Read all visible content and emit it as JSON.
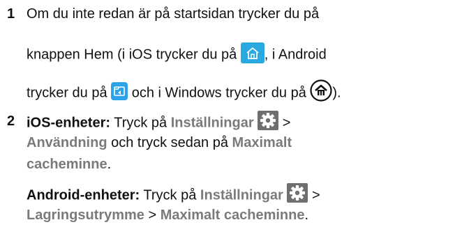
{
  "step1": {
    "number": "1",
    "line1": "Om du inte redan är på startsidan trycker du på",
    "line2_pre": "knappen Hem (i iOS trycker du på ",
    "line2_post": ", i Android",
    "line3_pre": "trycker du på ",
    "line3_mid": " och i Windows trycker du på ",
    "line3_post": ")."
  },
  "step2": {
    "number": "2",
    "ios_label": "iOS-enheter:",
    "ios_text1": " Tryck på ",
    "ios_settings": "Inställningar",
    "ios_gt1": " >",
    "ios_usage": "Användning",
    "ios_text2": " och tryck sedan på ",
    "ios_maxcache1": "Maximalt",
    "ios_maxcache2": "cacheminne",
    "ios_period": ".",
    "android_label": "Android-enheter:",
    "android_text1": " Tryck på ",
    "android_settings": "Inställningar",
    "android_gt1": " >",
    "android_storage": "Lagringsutrymme",
    "android_gt2": " > ",
    "android_maxcache": "Maximalt cacheminne",
    "android_period": "."
  },
  "icons": {
    "ios_home": "home-icon",
    "android_home": "android-home-icon",
    "windows_home": "windows-home-icon",
    "settings": "gear-icon"
  },
  "colors": {
    "ui_text": "#7a7a7a",
    "ios_home_bg": "#29a9e0",
    "android_home_bg": "#2aa3e8",
    "gear_bg": "#6f6f6f"
  }
}
